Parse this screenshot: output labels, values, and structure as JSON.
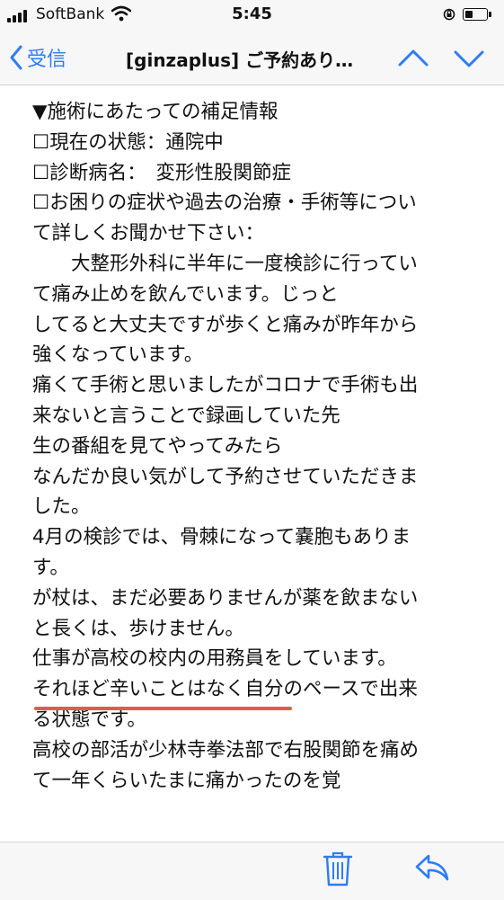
{
  "status_bar": {
    "carrier": "SoftBank",
    "time": "5:45",
    "battery_level": 0.35
  },
  "nav": {
    "back_label": "受信",
    "title": "[ginzaplus] ご予約あり…"
  },
  "email": {
    "lines": [
      "▼施術にあたっての補足情報",
      "☐現在の状態：通院中",
      "☐診断病名：　変形性股関節症",
      "☐お困りの症状や過去の治療・手術等につい",
      "て詳しくお聞かせ下さい：",
      "　　大整形外科に半年に一度検診に行ってい",
      "て痛み止めを飲んでいます。じっと",
      "してると大丈夫ですが歩くと痛みが昨年から",
      "強くなっています。",
      "痛くて手術と思いましたがコロナで手術も出",
      "来ないと言うことで録画していた先",
      "生の番組を見てやってみたら",
      "なんだか良い気がして予約させていただきま",
      "した。",
      "4月の検診では、骨棘になって嚢胞もありま",
      "す。",
      "が杖は、まだ必要ありませんが薬を飲まない",
      "と長くは、歩けません。",
      "仕事が高校の校内の用務員をしています。",
      "それほど辛いことはなく自分のペースで出来",
      "る状態です。",
      "高校の部活が少林寺拳法部で右股関節を痛め",
      "て一年くらいたまに痛かったのを覚"
    ]
  },
  "colors": {
    "accent": "#2f7cf6",
    "underline": "#e25a4a"
  },
  "icons": [
    "signal-icon",
    "wifi-icon",
    "orientation-lock-icon",
    "battery-icon",
    "chevron-left-icon",
    "chevron-up-icon",
    "chevron-down-icon",
    "trash-icon",
    "reply-icon"
  ]
}
